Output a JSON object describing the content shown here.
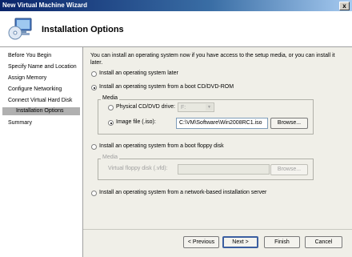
{
  "window": {
    "title": "New Virtual Machine Wizard",
    "close_glyph": "x"
  },
  "header": {
    "title": "Installation Options",
    "icon": "computer-disk-icon"
  },
  "sidebar": {
    "items": [
      {
        "label": "Before You Begin"
      },
      {
        "label": "Specify Name and Location"
      },
      {
        "label": "Assign Memory"
      },
      {
        "label": "Configure Networking"
      },
      {
        "label": "Connect Virtual Hard Disk"
      },
      {
        "label": "Installation Options",
        "active": true
      },
      {
        "label": "Summary"
      }
    ]
  },
  "main": {
    "intro_line1": "You can install an operating system now if you have access to the setup media, or you can install it",
    "intro_line2": "later.",
    "options": {
      "later": "Install an operating system later",
      "cd": "Install an operating system from a boot CD/DVD-ROM",
      "floppy": "Install an operating system from a boot floppy disk",
      "network": "Install an operating system from a network-based installation server"
    },
    "selected_option": "cd",
    "media_cd": {
      "legend": "Media",
      "physical_label": "Physical CD/DVD drive:",
      "physical_value": "F:",
      "image_label": "Image file (.iso):",
      "image_value": "C:\\VM\\Software\\Win2008RC1.iso",
      "browse_label": "Browse...",
      "selected": "image"
    },
    "media_floppy": {
      "legend": "Media",
      "vfd_label": "Virtual floppy disk (.vfd):",
      "vfd_value": "",
      "browse_label": "Browse..."
    }
  },
  "footer": {
    "previous_label": "< Previous",
    "next_label": "Next >",
    "finish_label": "Finish",
    "cancel_label": "Cancel"
  }
}
